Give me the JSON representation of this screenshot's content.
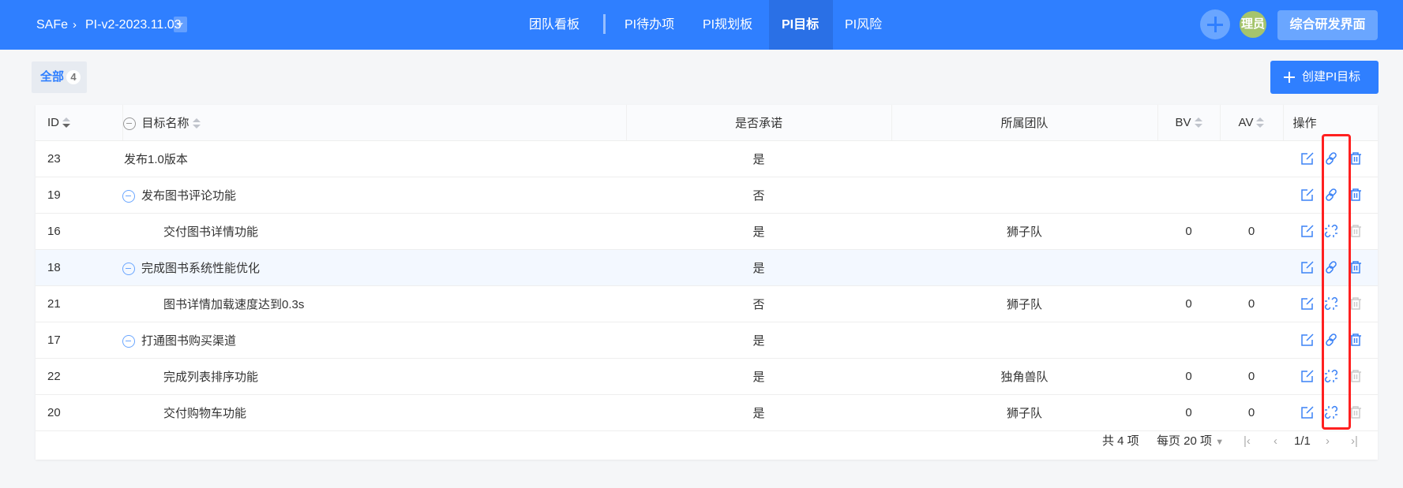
{
  "header": {
    "breadcrumb": [
      "SAFe",
      "PI-v2-2023.11.03"
    ],
    "nav": [
      "团队看板",
      "PI待办项",
      "PI规划板",
      "PI目标",
      "PI风险"
    ],
    "active_nav": "PI目标",
    "avatar_text": "理员",
    "switch_button": "综合研发界面"
  },
  "toolbar": {
    "tab_label": "全部",
    "tab_count": "4",
    "create_button": "创建PI目标"
  },
  "table": {
    "columns": [
      "ID",
      "目标名称",
      "是否承诺",
      "所属团队",
      "BV",
      "AV",
      "操作"
    ],
    "rows": [
      {
        "id": "23",
        "name": "发布1.0版本",
        "level": 0,
        "collapsible": false,
        "committed": "是",
        "team": "",
        "bv": "",
        "av": "",
        "child": false
      },
      {
        "id": "19",
        "name": "发布图书评论功能",
        "level": 0,
        "collapsible": true,
        "committed": "否",
        "team": "",
        "bv": "",
        "av": "",
        "child": false
      },
      {
        "id": "16",
        "name": "交付图书详情功能",
        "level": 1,
        "collapsible": false,
        "committed": "是",
        "team": "狮子队",
        "bv": "0",
        "av": "0",
        "child": true
      },
      {
        "id": "18",
        "name": "完成图书系统性能优化",
        "level": 0,
        "collapsible": true,
        "committed": "是",
        "team": "",
        "bv": "",
        "av": "",
        "child": false
      },
      {
        "id": "21",
        "name": "图书详情加载速度达到0.3s",
        "level": 1,
        "collapsible": false,
        "committed": "否",
        "team": "狮子队",
        "bv": "0",
        "av": "0",
        "child": true
      },
      {
        "id": "17",
        "name": "打通图书购买渠道",
        "level": 0,
        "collapsible": true,
        "committed": "是",
        "team": "",
        "bv": "",
        "av": "",
        "child": false
      },
      {
        "id": "22",
        "name": "完成列表排序功能",
        "level": 1,
        "collapsible": false,
        "committed": "是",
        "team": "独角兽队",
        "bv": "0",
        "av": "0",
        "child": true
      },
      {
        "id": "20",
        "name": "交付购物车功能",
        "level": 1,
        "collapsible": false,
        "committed": "是",
        "team": "狮子队",
        "bv": "0",
        "av": "0",
        "child": true
      }
    ]
  },
  "pagination": {
    "total": "共 4 项",
    "page_size": "每页 20 项",
    "page": "1/1"
  },
  "colors": {
    "primary": "#2f7fff",
    "highlight": "#ff2020"
  }
}
